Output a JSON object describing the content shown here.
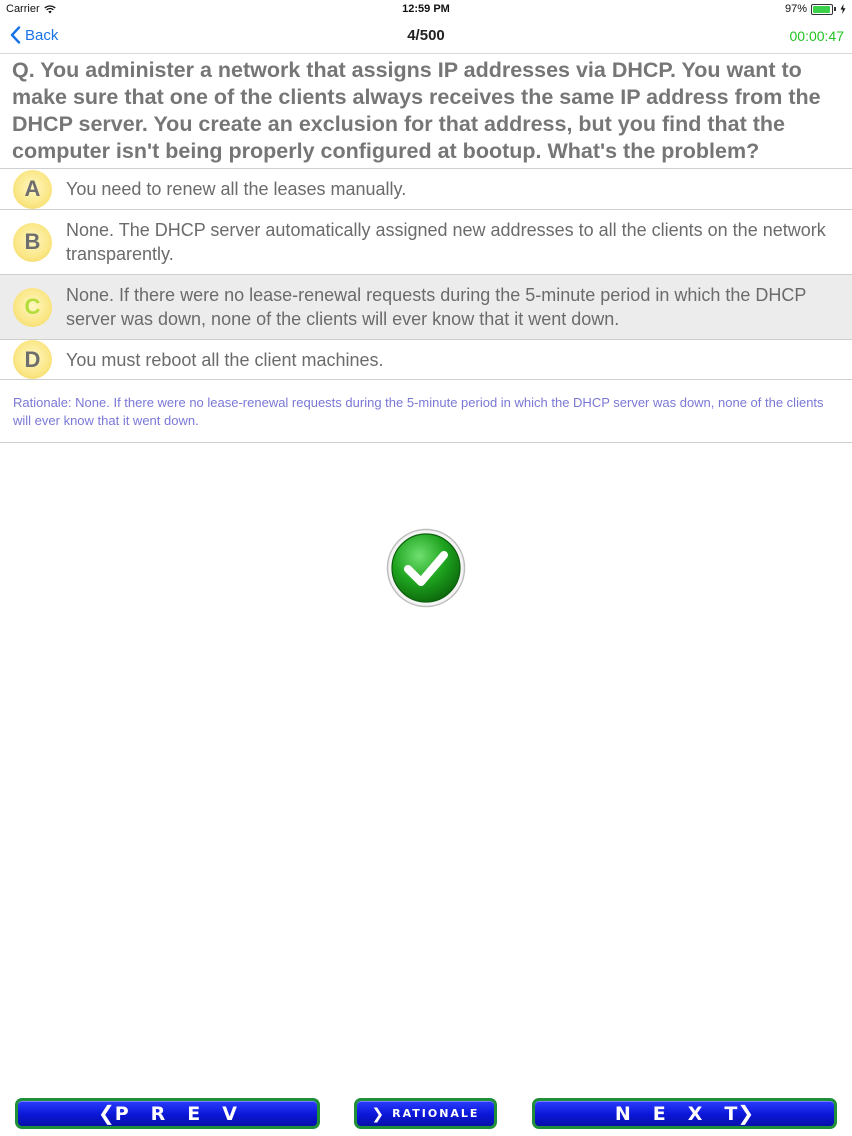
{
  "status_bar": {
    "carrier": "Carrier",
    "time": "12:59 PM",
    "battery": "97%",
    "battery_level": 0.97
  },
  "nav": {
    "back_label": "Back",
    "title": "4/500",
    "timer": "00:00:47"
  },
  "question": {
    "text": "Q. You administer a network that assigns IP addresses via DHCP. You want to make sure that one of the clients always receives the same IP address from the DHCP server. You create an exclusion for that address, but you find that the computer isn't being properly configured at bootup. What's the problem?"
  },
  "options": [
    {
      "letter": "A",
      "text": "You need to renew all the leases manually."
    },
    {
      "letter": "B",
      "text": "None. The DHCP server automatically assigned new addresses to all the clients on the network transparently."
    },
    {
      "letter": "C",
      "text": "None. If there were no lease-renewal requests during the 5-minute period in which the DHCP server was down, none of the clients will ever know that it went down.",
      "selected": true
    },
    {
      "letter": "D",
      "text": "You must reboot all the client machines."
    }
  ],
  "rationale": {
    "text": "Rationale: None. If there were no lease-renewal requests during the 5-minute period in which the DHCP server was down, none of the clients will ever know that it went down."
  },
  "result": {
    "icon": "check-circle-icon",
    "color": "#1fa41f"
  },
  "buttons": {
    "prev_label": "PREV",
    "rationale_label": "RATIONALE",
    "next_label": "NEXT"
  },
  "colors": {
    "accent": "#1a73e8",
    "timer": "#22c322",
    "rationale": "#7a78d6",
    "button": "#0b16d6"
  }
}
